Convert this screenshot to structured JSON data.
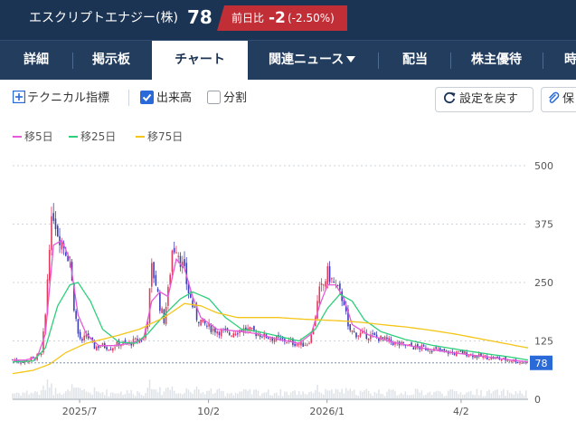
{
  "header": {
    "stock_name": "エスクリプトエナジー(株)",
    "price": "78",
    "change_label": "前日比",
    "change_value": "-2",
    "change_pct": "(-2.50%)"
  },
  "tabs": [
    {
      "label": "詳細"
    },
    {
      "label": "掲示板"
    },
    {
      "label": "チャート"
    },
    {
      "label": "関連ニュース"
    },
    {
      "label": "配当"
    },
    {
      "label": "株主優待"
    },
    {
      "label": "時"
    }
  ],
  "toolbar": {
    "technical_label": "テクニカル指標",
    "volume_label": "出来高",
    "volume_checked": true,
    "split_label": "分割",
    "split_checked": false,
    "reset_label": "設定を戻す",
    "save_label": "保"
  },
  "legend": [
    {
      "label": "移5日",
      "color": "#e45ad8"
    },
    {
      "label": "移25日",
      "color": "#2ecf7a"
    },
    {
      "label": "移75日",
      "color": "#f5c518"
    }
  ],
  "chart_data": {
    "type": "candlestick",
    "x_ticks": [
      "2025/7",
      "10/2",
      "2026/1",
      "4/2"
    ],
    "y_ticks": [
      500,
      375,
      250,
      125,
      0
    ],
    "ylim": [
      0,
      500
    ],
    "current_price": 78,
    "current_price_label": "78",
    "grid": "horizontal-dashed",
    "up_color": "#e23a5d",
    "down_color": "#3b3fb5",
    "close_path": [
      [
        0,
        85
      ],
      [
        5,
        80
      ],
      [
        10,
        88
      ],
      [
        14,
        95
      ],
      [
        16,
        180
      ],
      [
        18,
        340
      ],
      [
        20,
        400
      ],
      [
        22,
        360
      ],
      [
        24,
        340
      ],
      [
        26,
        320
      ],
      [
        28,
        300
      ],
      [
        30,
        200
      ],
      [
        32,
        140
      ],
      [
        34,
        120
      ],
      [
        36,
        140
      ],
      [
        38,
        125
      ],
      [
        40,
        112
      ],
      [
        44,
        115
      ],
      [
        48,
        110
      ],
      [
        52,
        120
      ],
      [
        56,
        118
      ],
      [
        60,
        125
      ],
      [
        64,
        130
      ],
      [
        66,
        175
      ],
      [
        68,
        280
      ],
      [
        70,
        250
      ],
      [
        72,
        200
      ],
      [
        74,
        170
      ],
      [
        76,
        230
      ],
      [
        78,
        320
      ],
      [
        80,
        330
      ],
      [
        82,
        300
      ],
      [
        84,
        270
      ],
      [
        86,
        230
      ],
      [
        88,
        200
      ],
      [
        90,
        175
      ],
      [
        94,
        160
      ],
      [
        98,
        150
      ],
      [
        102,
        145
      ],
      [
        106,
        140
      ],
      [
        110,
        148
      ],
      [
        114,
        150
      ],
      [
        118,
        143
      ],
      [
        122,
        138
      ],
      [
        126,
        132
      ],
      [
        130,
        128
      ],
      [
        134,
        125
      ],
      [
        138,
        120
      ],
      [
        142,
        118
      ],
      [
        144,
        120
      ],
      [
        146,
        135
      ],
      [
        148,
        180
      ],
      [
        150,
        230
      ],
      [
        152,
        245
      ],
      [
        154,
        270
      ],
      [
        156,
        255
      ],
      [
        158,
        240
      ],
      [
        160,
        225
      ],
      [
        162,
        210
      ],
      [
        164,
        150
      ],
      [
        168,
        140
      ],
      [
        172,
        138
      ],
      [
        176,
        135
      ],
      [
        180,
        130
      ],
      [
        184,
        125
      ],
      [
        188,
        118
      ],
      [
        192,
        115
      ],
      [
        196,
        112
      ],
      [
        200,
        110
      ],
      [
        204,
        108
      ],
      [
        208,
        104
      ],
      [
        212,
        102
      ],
      [
        216,
        98
      ],
      [
        220,
        100
      ],
      [
        224,
        96
      ],
      [
        228,
        92
      ],
      [
        232,
        90
      ],
      [
        236,
        88
      ],
      [
        240,
        85
      ],
      [
        244,
        84
      ],
      [
        248,
        80
      ],
      [
        252,
        78
      ]
    ],
    "series": [
      {
        "name": "移5日",
        "color": "#e45ad8",
        "values": [
          [
            0,
            84
          ],
          [
            6,
            84
          ],
          [
            12,
            90
          ],
          [
            16,
            140
          ],
          [
            20,
            330
          ],
          [
            24,
            340
          ],
          [
            28,
            300
          ],
          [
            32,
            180
          ],
          [
            36,
            140
          ],
          [
            42,
            115
          ],
          [
            50,
            115
          ],
          [
            58,
            120
          ],
          [
            64,
            130
          ],
          [
            68,
            210
          ],
          [
            72,
            230
          ],
          [
            76,
            220
          ],
          [
            80,
            300
          ],
          [
            84,
            280
          ],
          [
            88,
            220
          ],
          [
            92,
            175
          ],
          [
            100,
            150
          ],
          [
            110,
            146
          ],
          [
            120,
            140
          ],
          [
            130,
            128
          ],
          [
            140,
            120
          ],
          [
            146,
            140
          ],
          [
            150,
            200
          ],
          [
            154,
            245
          ],
          [
            158,
            245
          ],
          [
            162,
            215
          ],
          [
            166,
            160
          ],
          [
            174,
            138
          ],
          [
            186,
            122
          ],
          [
            200,
            110
          ],
          [
            214,
            100
          ],
          [
            228,
            93
          ],
          [
            240,
            86
          ],
          [
            252,
            80
          ]
        ]
      },
      {
        "name": "移25日",
        "color": "#2ecf7a",
        "values": [
          [
            0,
            80
          ],
          [
            10,
            82
          ],
          [
            16,
            110
          ],
          [
            22,
            200
          ],
          [
            28,
            245
          ],
          [
            32,
            250
          ],
          [
            38,
            210
          ],
          [
            44,
            150
          ],
          [
            52,
            122
          ],
          [
            60,
            120
          ],
          [
            66,
            140
          ],
          [
            74,
            180
          ],
          [
            82,
            215
          ],
          [
            88,
            230
          ],
          [
            96,
            215
          ],
          [
            104,
            175
          ],
          [
            112,
            150
          ],
          [
            120,
            145
          ],
          [
            130,
            135
          ],
          [
            140,
            125
          ],
          [
            148,
            150
          ],
          [
            154,
            195
          ],
          [
            160,
            225
          ],
          [
            166,
            210
          ],
          [
            172,
            170
          ],
          [
            180,
            145
          ],
          [
            192,
            128
          ],
          [
            206,
            115
          ],
          [
            220,
            105
          ],
          [
            234,
            96
          ],
          [
            244,
            90
          ],
          [
            252,
            84
          ]
        ]
      },
      {
        "name": "移75日",
        "color": "#f5c518",
        "values": [
          [
            0,
            55
          ],
          [
            10,
            62
          ],
          [
            18,
            75
          ],
          [
            26,
            100
          ],
          [
            36,
            120
          ],
          [
            50,
            135
          ],
          [
            62,
            150
          ],
          [
            74,
            175
          ],
          [
            84,
            205
          ],
          [
            92,
            200
          ],
          [
            100,
            185
          ],
          [
            110,
            175
          ],
          [
            120,
            175
          ],
          [
            130,
            175
          ],
          [
            140,
            172
          ],
          [
            150,
            170
          ],
          [
            160,
            168
          ],
          [
            170,
            165
          ],
          [
            180,
            160
          ],
          [
            192,
            155
          ],
          [
            204,
            148
          ],
          [
            216,
            140
          ],
          [
            228,
            130
          ],
          [
            240,
            120
          ],
          [
            252,
            110
          ]
        ]
      }
    ]
  }
}
